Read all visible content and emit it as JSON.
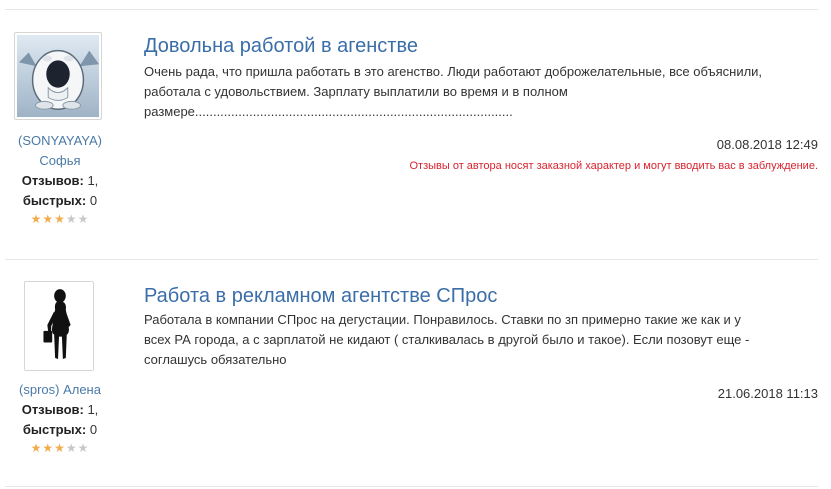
{
  "reviews": [
    {
      "title": "Довольна работой в агенстве",
      "text_lines": [
        "Очень рада, что пришла работать в это агенство. Люди работают доброжелательные, все объяснили,",
        "работала с удовольствием. Зарплату выплатили во время и в полном",
        "размере........................................................................................"
      ],
      "date": "08.08.2018 12:49",
      "warning": "Отзывы от автора носят заказной характер и могут вводить вас в заблуждение.",
      "author": {
        "line1": "(SONYAYAYA)",
        "line2": "Софья",
        "reviews_label": "Отзывов:",
        "reviews_count": "1,",
        "quick_label": "быстрых:",
        "quick_count": "0",
        "rating": 3,
        "rating_max": 5,
        "avatar_icon": "yeti-avatar-icon"
      }
    },
    {
      "title": "Работа в рекламном агентстве СПрос",
      "text_lines": [
        "Работала в компании СПрос на дегустации. Понравилось. Ставки по зп примерно такие же как и у",
        "всех РА города, а с зарплатой не кидают ( сталкивалась в другой было и такое). Если позовут еще -",
        "соглашусь обязательно"
      ],
      "date": "21.06.2018 11:13",
      "author": {
        "line1": "(spros) Алена",
        "reviews_label": "Отзывов:",
        "reviews_count": "1,",
        "quick_label": "быстрых:",
        "quick_count": "0",
        "rating": 3,
        "rating_max": 5,
        "avatar_icon": "woman-silhouette-avatar-icon"
      }
    }
  ],
  "colors": {
    "title": "#3b6ea8",
    "author_link": "#4a7aa6",
    "warning": "#d9232e",
    "star_on": "#f0ad4e",
    "star_off": "#c8c8c8"
  }
}
